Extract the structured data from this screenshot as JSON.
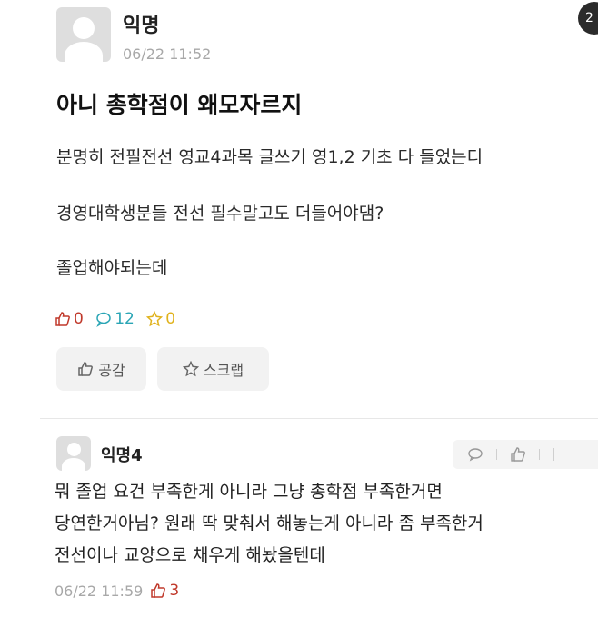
{
  "post": {
    "author": "익명",
    "time": "06/22 11:52",
    "title": "아니 총학점이 왜모자르지",
    "lines": [
      "분명히 전필전선 영교4과목 글쓰기 영1,2 기초 다 들었는디",
      "경영대학생분들 전선 필수말고도 더들어야댐?",
      "졸업해야되는데"
    ],
    "stats": {
      "likes": "0",
      "comments": "12",
      "scraps": "0"
    },
    "buttons": {
      "like": "공감",
      "scrap": "스크랩"
    }
  },
  "comment": {
    "author": "익명4",
    "lines": [
      "뭐 졸업 요건 부족한게 아니라 그냥 총학점 부족한거면",
      "당연한거아님? 원래 딱 맞춰서 해놓는게 아니라 좀 부족한거",
      "전선이나 교양으로 채우게 해놨을텐데"
    ],
    "time": "06/22 11:59",
    "likes": "3"
  },
  "corner_badge": "2",
  "colors": {
    "like": "#c0392b",
    "comment": "#2aa5b5",
    "scrap": "#e0b21c",
    "meta": "#a8a8a8"
  }
}
